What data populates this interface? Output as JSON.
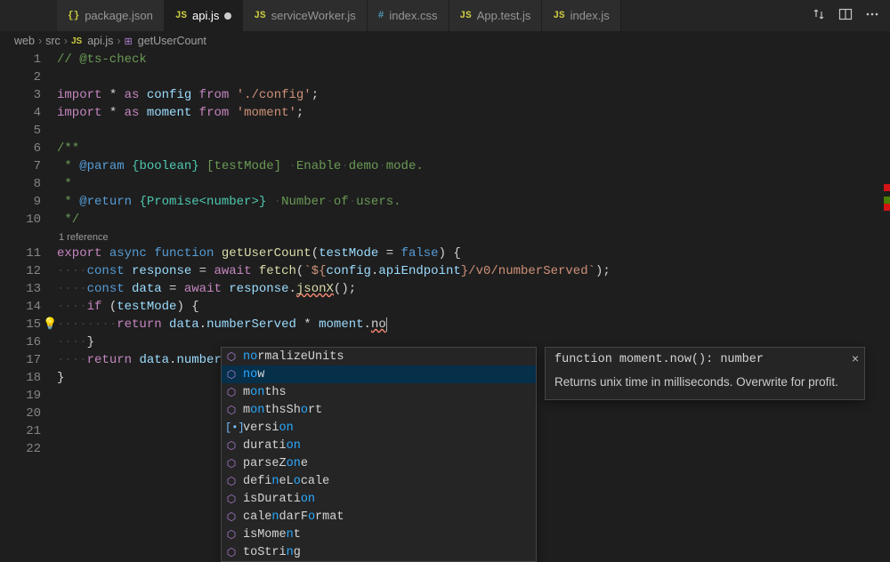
{
  "tabs": [
    {
      "icon": "{}",
      "iconClass": "lang-json",
      "label": "package.json",
      "active": false,
      "dirty": false
    },
    {
      "icon": "JS",
      "iconClass": "lang-js",
      "label": "api.js",
      "active": true,
      "dirty": true
    },
    {
      "icon": "JS",
      "iconClass": "lang-js",
      "label": "serviceWorker.js",
      "active": false,
      "dirty": false
    },
    {
      "icon": "#",
      "iconClass": "lang-css",
      "label": "index.css",
      "active": false,
      "dirty": false
    },
    {
      "icon": "JS",
      "iconClass": "lang-js",
      "label": "App.test.js",
      "active": false,
      "dirty": false
    },
    {
      "icon": "JS",
      "iconClass": "lang-js",
      "label": "index.js",
      "active": false,
      "dirty": false
    }
  ],
  "breadcrumb": {
    "seg0": "web",
    "seg1": "src",
    "file_icon": "JS",
    "seg2": "api.js",
    "fn_icon": "⊞",
    "seg3": "getUserCount"
  },
  "codelens": "1 reference",
  "line_numbers": [
    "1",
    "2",
    "3",
    "4",
    "5",
    "6",
    "7",
    "8",
    "9",
    "10",
    "11",
    "12",
    "13",
    "14",
    "15",
    "16",
    "17",
    "18",
    "19",
    "20",
    "21",
    "22"
  ],
  "lightbulb_line": 15,
  "suggest": {
    "items": [
      {
        "kind": "method",
        "label_pre": "no",
        "label_mid": "",
        "label_post": "rmalizeUnits",
        "hl": [
          [
            0,
            2
          ]
        ]
      },
      {
        "kind": "method",
        "label_pre": "no",
        "label_mid": "",
        "label_post": "w",
        "hl": [
          [
            0,
            2
          ]
        ],
        "selected": true
      },
      {
        "kind": "method",
        "label_pre": "m",
        "label_mid": "on",
        "label_post": "ths",
        "hl": []
      },
      {
        "kind": "method",
        "label_pre": "m",
        "label_mid": "on",
        "label_post": "thsSh",
        "tail": "ort",
        "hl": []
      },
      {
        "kind": "const",
        "label_pre": "versi",
        "label_mid": "on",
        "label_post": "",
        "hl": []
      },
      {
        "kind": "method",
        "label_pre": "durati",
        "label_mid": "on",
        "label_post": "",
        "hl": []
      },
      {
        "kind": "method",
        "label_pre": "parseZ",
        "label_mid": "on",
        "label_post": "e",
        "hl": []
      },
      {
        "kind": "method",
        "label_pre": "defi",
        "label_mid_a": "n",
        "label_mid_b": "eL",
        "label_mid_c": "o",
        "label_post": "cale"
      },
      {
        "kind": "method",
        "label_pre": "isDurati",
        "label_mid": "on",
        "label_post": "",
        "hl": []
      },
      {
        "kind": "method",
        "label_pre": "cale",
        "label_mid_a": "n",
        "label_mid_b": "d",
        "label_mid_c": "arF",
        "label_mid_d": "o",
        "label_post": "rmat"
      },
      {
        "kind": "method",
        "label_pre": "isMome",
        "label_mid": "n",
        "label_post": "t"
      },
      {
        "kind": "method",
        "label_pre": "toStri",
        "label_mid": "n",
        "label_post": "g"
      }
    ]
  },
  "doc": {
    "sig": "function moment.now(): number",
    "desc": "Returns unix time in milliseconds. Overwrite for profit."
  }
}
